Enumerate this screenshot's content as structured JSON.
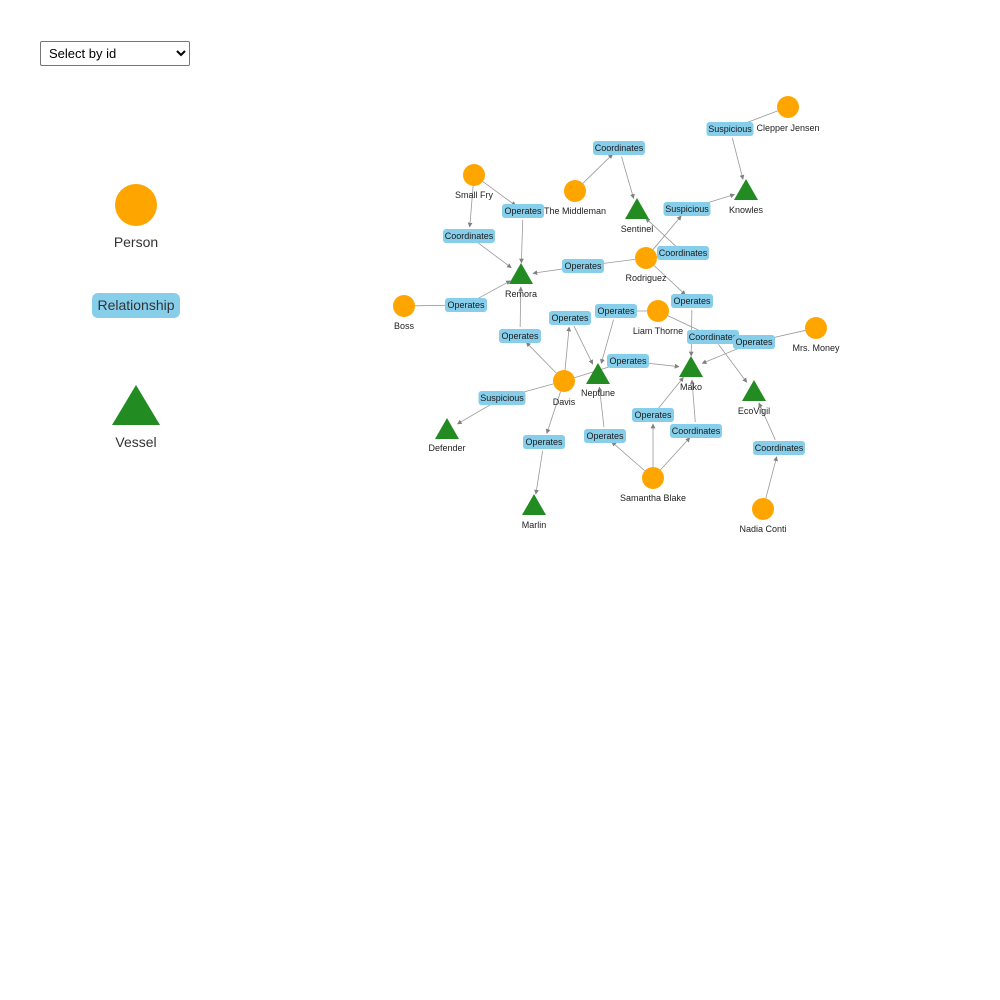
{
  "select": {
    "selected": "Select by id",
    "options": [
      "Select by id"
    ]
  },
  "legend": {
    "person": "Person",
    "relationship": "Relationship",
    "vessel": "Vessel"
  },
  "colors": {
    "person": "#FFA500",
    "vessel": "#228B22",
    "relationship": "#87CEEB",
    "edge": "#999999"
  },
  "graph": {
    "nodes": [
      {
        "id": "Small Fry",
        "type": "person"
      },
      {
        "id": "The Middleman",
        "type": "person"
      },
      {
        "id": "Clepper Jensen",
        "type": "person"
      },
      {
        "id": "Rodriguez",
        "type": "person"
      },
      {
        "id": "Boss",
        "type": "person"
      },
      {
        "id": "Liam Thorne",
        "type": "person"
      },
      {
        "id": "Mrs. Money",
        "type": "person"
      },
      {
        "id": "Davis",
        "type": "person"
      },
      {
        "id": "Samantha Blake",
        "type": "person"
      },
      {
        "id": "Nadia Conti",
        "type": "person"
      },
      {
        "id": "Sentinel",
        "type": "vessel"
      },
      {
        "id": "Knowles",
        "type": "vessel"
      },
      {
        "id": "Remora",
        "type": "vessel"
      },
      {
        "id": "Neptune",
        "type": "vessel"
      },
      {
        "id": "Mako",
        "type": "vessel"
      },
      {
        "id": "EcoVigil",
        "type": "vessel"
      },
      {
        "id": "Defender",
        "type": "vessel"
      },
      {
        "id": "Marlin",
        "type": "vessel"
      }
    ],
    "relationships": [
      {
        "label": "Suspicious",
        "source": "Clepper Jensen",
        "target": "Knowles"
      },
      {
        "label": "Coordinates",
        "source": "The Middleman",
        "target": "Sentinel"
      },
      {
        "label": "Operates",
        "source": "Small Fry",
        "target": "Remora"
      },
      {
        "label": "Coordinates",
        "source": "Small Fry",
        "target": "Remora"
      },
      {
        "label": "Suspicious",
        "source": "Rodriguez",
        "target": "Knowles"
      },
      {
        "label": "Coordinates",
        "source": "Rodriguez",
        "target": "Sentinel"
      },
      {
        "label": "Operates",
        "source": "Rodriguez",
        "target": "Remora"
      },
      {
        "label": "Operates",
        "source": "Rodriguez",
        "target": "Mako"
      },
      {
        "label": "Operates",
        "source": "Boss",
        "target": "Remora"
      },
      {
        "label": "Operates",
        "source": "Liam Thorne",
        "target": "Neptune"
      },
      {
        "label": "Coordinates",
        "source": "Liam Thorne",
        "target": "EcoVigil"
      },
      {
        "label": "Operates",
        "source": "Mrs. Money",
        "target": "Mako"
      },
      {
        "label": "Operates",
        "source": "Davis",
        "target": "Remora"
      },
      {
        "label": "Operates",
        "source": "Davis",
        "target": "Neptune"
      },
      {
        "label": "Operates",
        "source": "Davis",
        "target": "Mako"
      },
      {
        "label": "Suspicious",
        "source": "Davis",
        "target": "Defender"
      },
      {
        "label": "Operates",
        "source": "Davis",
        "target": "Marlin"
      },
      {
        "label": "Operates",
        "source": "Samantha Blake",
        "target": "Neptune"
      },
      {
        "label": "Operates",
        "source": "Samantha Blake",
        "target": "Mako"
      },
      {
        "label": "Coordinates",
        "source": "Samantha Blake",
        "target": "Mako"
      },
      {
        "label": "Coordinates",
        "source": "Nadia Conti",
        "target": "EcoVigil"
      }
    ]
  }
}
